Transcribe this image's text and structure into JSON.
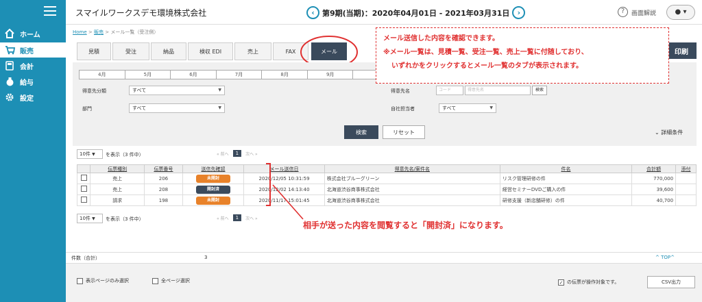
{
  "sidebar": {
    "items": [
      {
        "label": "ホーム"
      },
      {
        "label": "販売"
      },
      {
        "label": "会計"
      },
      {
        "label": "給与"
      },
      {
        "label": "設定"
      }
    ]
  },
  "header": {
    "company": "スマイルワークスデモ環境株式会社",
    "period": "第9期(当期)：2020年04月01日 - 2021年03月31日",
    "help": "画面解説",
    "user_icon": "▾"
  },
  "breadcrumb": [
    "Home",
    "販売",
    "メール一覧（受注側）"
  ],
  "tabs": [
    {
      "label": "見積"
    },
    {
      "label": "受注"
    },
    {
      "label": "納品"
    },
    {
      "label": "検収 EDI"
    },
    {
      "label": "売上"
    },
    {
      "label": "FAX"
    },
    {
      "label": "メール"
    }
  ],
  "print_button": "印刷",
  "months": [
    "4月",
    "5月",
    "6月",
    "7月",
    "8月",
    "9月",
    "",
    "",
    "",
    "",
    "",
    ""
  ],
  "filters": {
    "tokui_bunrui_label": "得意先分類",
    "tokui_bunrui_value": "すべて",
    "bumon_label": "部門",
    "bumon_value": "すべて",
    "tokui_name_label": "得意先名",
    "code_placeholder": "コード",
    "name_placeholder": "得意先名",
    "search_small": "検索",
    "tanto_label": "自社担当者",
    "tanto_value": "すべて"
  },
  "search_button": "検索",
  "reset_button": "リセット",
  "detail_label": "詳細条件",
  "per_page": "10件",
  "per_page_label": "を表示（3 件中）",
  "pager": {
    "prev": "« 前へ",
    "page": "1",
    "next": "次へ »"
  },
  "table": {
    "headers": [
      "",
      "伝票種別",
      "伝票番号",
      "送信先確認",
      "メール送信日",
      "得意先名/案件名",
      "件名",
      "合計額",
      "添付"
    ],
    "rows": [
      {
        "type": "売上",
        "number": "206",
        "status": "未開封",
        "status_color": "#e8822a",
        "date": "2020/12/05 10:31:59",
        "customer": "株式会社ブルーグリーン",
        "subject": "リスク管理研修の件",
        "amount": "770,000"
      },
      {
        "type": "売上",
        "number": "208",
        "status": "開封済",
        "status_color": "#3a4a5c",
        "date": "2020/12/02 14:13:40",
        "customer": "北海道渋谷商事株式会社",
        "subject": "経営セミナーDVDご購入の件",
        "amount": "39,600"
      },
      {
        "type": "請求",
        "number": "198",
        "status": "未開封",
        "status_color": "#e8822a",
        "date": "2020/11/17 15:01:45",
        "customer": "北海道渋谷商事株式会社",
        "subject": "研修支援（新店舗研修）の件",
        "amount": "40,700"
      }
    ]
  },
  "annotations": {
    "box_line1": "メール送信した内容を確認できます。",
    "box_line2": "※メール一覧は、見積一覧、受注一覧、売上一覧に付随しており、",
    "box_line3": "いずれかをクリックするとメール一覧のタブが表示されます。",
    "bottom": "相手が送った内容を閲覧すると「開封済」になります。"
  },
  "footer": {
    "count_label": "件数（合計）",
    "count_value": "3",
    "top_link": "^ TOP^",
    "page_only": "表示ページのみ選択",
    "all_pages": "全ページ選択",
    "target_note": "の伝票が操作対象です。",
    "csv": "CSV出力"
  }
}
